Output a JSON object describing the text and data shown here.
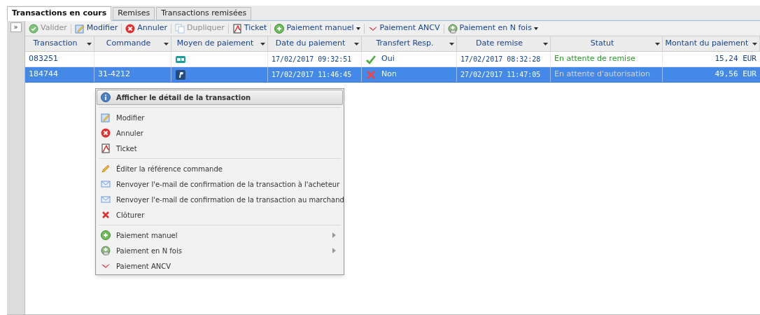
{
  "tabs": [
    {
      "label": "Transactions en cours",
      "selected": true
    },
    {
      "label": "Remises",
      "selected": false
    },
    {
      "label": "Transactions remisées",
      "selected": false
    }
  ],
  "sidebar": {
    "expand_label": "»"
  },
  "toolbar": [
    {
      "label": "Valider",
      "disabled": true,
      "dropdown": false
    },
    {
      "label": "Modifier",
      "disabled": false,
      "dropdown": false
    },
    {
      "label": "Annuler",
      "disabled": false,
      "dropdown": false
    },
    {
      "label": "Dupliquer",
      "disabled": true,
      "dropdown": false
    },
    {
      "label": "Ticket",
      "disabled": false,
      "dropdown": false
    },
    {
      "label": "Paiement manuel",
      "disabled": false,
      "dropdown": true
    },
    {
      "label": "Paiement ANCV",
      "disabled": false,
      "dropdown": false
    },
    {
      "label": "Paiement en N fois",
      "disabled": false,
      "dropdown": true
    }
  ],
  "table": {
    "columns": [
      "Transaction",
      "Commande",
      "Moyen de paiement",
      "Date du paiement",
      "Transfert Resp.",
      "Date remise",
      "Statut",
      "Montant du paiement"
    ],
    "rows": [
      {
        "selected": false,
        "transaction": "083251",
        "commande": "",
        "payment_method": {
          "kind": "card"
        },
        "date_paiement": "17/02/2017 09:32:51",
        "transfert": {
          "text": "Oui",
          "ok": true
        },
        "date_remise": "17/02/2017 08:32:28",
        "statut": {
          "text": "En attente de remise",
          "color": "#2e9a2e"
        },
        "montant": "15,24 EUR"
      },
      {
        "selected": true,
        "transaction": "184744",
        "commande": "31-4212",
        "payment_method": {
          "kind": "paypal"
        },
        "date_paiement": "17/02/2017 11:46:45",
        "transfert": {
          "text": "Non",
          "ok": false
        },
        "date_remise": "27/02/2017 11:47:05",
        "statut": {
          "text": "En attente d'autorisation",
          "color": "#d4d4d4"
        },
        "montant": "49,56 EUR"
      }
    ]
  },
  "context_menu": {
    "groups": [
      [
        {
          "label": "Afficher le détail de la transaction",
          "selected": true,
          "submenu": false
        }
      ],
      [
        {
          "label": "Modifier",
          "selected": false,
          "submenu": false
        },
        {
          "label": "Annuler",
          "selected": false,
          "submenu": false
        },
        {
          "label": "Ticket",
          "selected": false,
          "submenu": false
        }
      ],
      [
        {
          "label": "Éditer la référence commande",
          "selected": false,
          "submenu": false
        },
        {
          "label": "Renvoyer l'e-mail de confirmation de la transaction à l'acheteur",
          "selected": false,
          "submenu": false
        },
        {
          "label": "Renvoyer l'e-mail de confirmation de la transaction au marchand",
          "selected": false,
          "submenu": false
        },
        {
          "label": "Clôturer",
          "selected": false,
          "submenu": false
        }
      ],
      [
        {
          "label": "Paiement manuel",
          "selected": false,
          "submenu": true
        },
        {
          "label": "Paiement en N fois",
          "selected": false,
          "submenu": true
        },
        {
          "label": "Paiement ANCV",
          "selected": false,
          "submenu": false
        }
      ]
    ]
  }
}
